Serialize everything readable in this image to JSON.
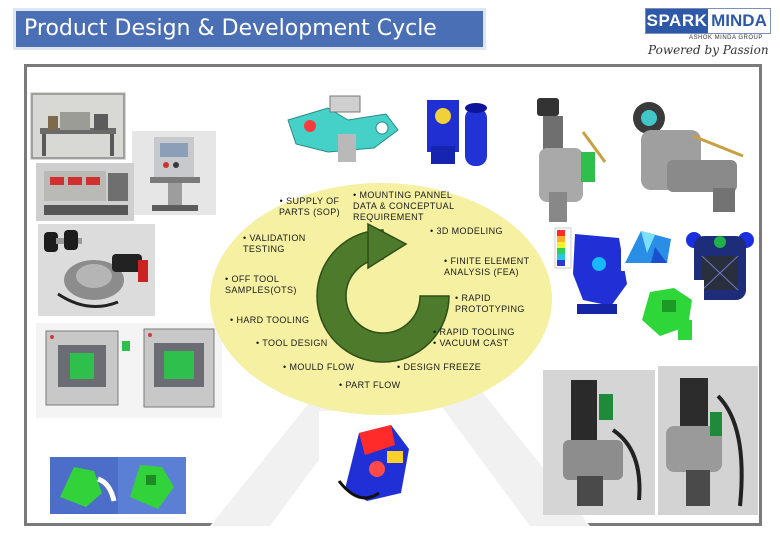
{
  "slide": {
    "title": "Product Design & Development Cycle"
  },
  "logo": {
    "spark": "SPARK",
    "minda": "MINDA",
    "group": "ASHOK MINDA GROUP",
    "tagline": "Powered by Passion"
  },
  "cycle": {
    "steps": [
      {
        "id": "mounting",
        "lines": [
          "• MOUNTING PANNEL",
          "DATA & CONCEPTUAL",
          "REQUIREMENT"
        ]
      },
      {
        "id": "supply",
        "lines": [
          "• SUPPLY OF",
          "PARTS (SOP)"
        ]
      },
      {
        "id": "modeling",
        "lines": [
          "• 3D MODELING"
        ]
      },
      {
        "id": "validation",
        "lines": [
          "• VALIDATION",
          "TESTING"
        ]
      },
      {
        "id": "fea",
        "lines": [
          "• FINITE ELEMENT",
          "ANALYSIS (FEA)"
        ]
      },
      {
        "id": "offtool",
        "lines": [
          "• OFF TOOL",
          "SAMPLES(OTS)"
        ]
      },
      {
        "id": "rapid-proto",
        "lines": [
          "• RAPID",
          "PROTOTYPING"
        ]
      },
      {
        "id": "hard-tooling",
        "lines": [
          "• HARD TOOLING"
        ]
      },
      {
        "id": "rapid-tooling",
        "lines": [
          "• RAPID TOOLING",
          "• VACUUM CAST"
        ]
      },
      {
        "id": "tool-design",
        "lines": [
          "• TOOL DESIGN"
        ]
      },
      {
        "id": "mould-flow",
        "lines": [
          "• MOULD FLOW"
        ]
      },
      {
        "id": "design-freeze",
        "lines": [
          "• DESIGN FREEZE"
        ]
      },
      {
        "id": "part-flow",
        "lines": [
          "• PART FLOW"
        ]
      }
    ]
  },
  "colors": {
    "title_bg": "#4a6fb4",
    "oval": "#f5f0a2",
    "arrow": "#4e7a2c",
    "arrow_outline": "#2f4f16"
  }
}
